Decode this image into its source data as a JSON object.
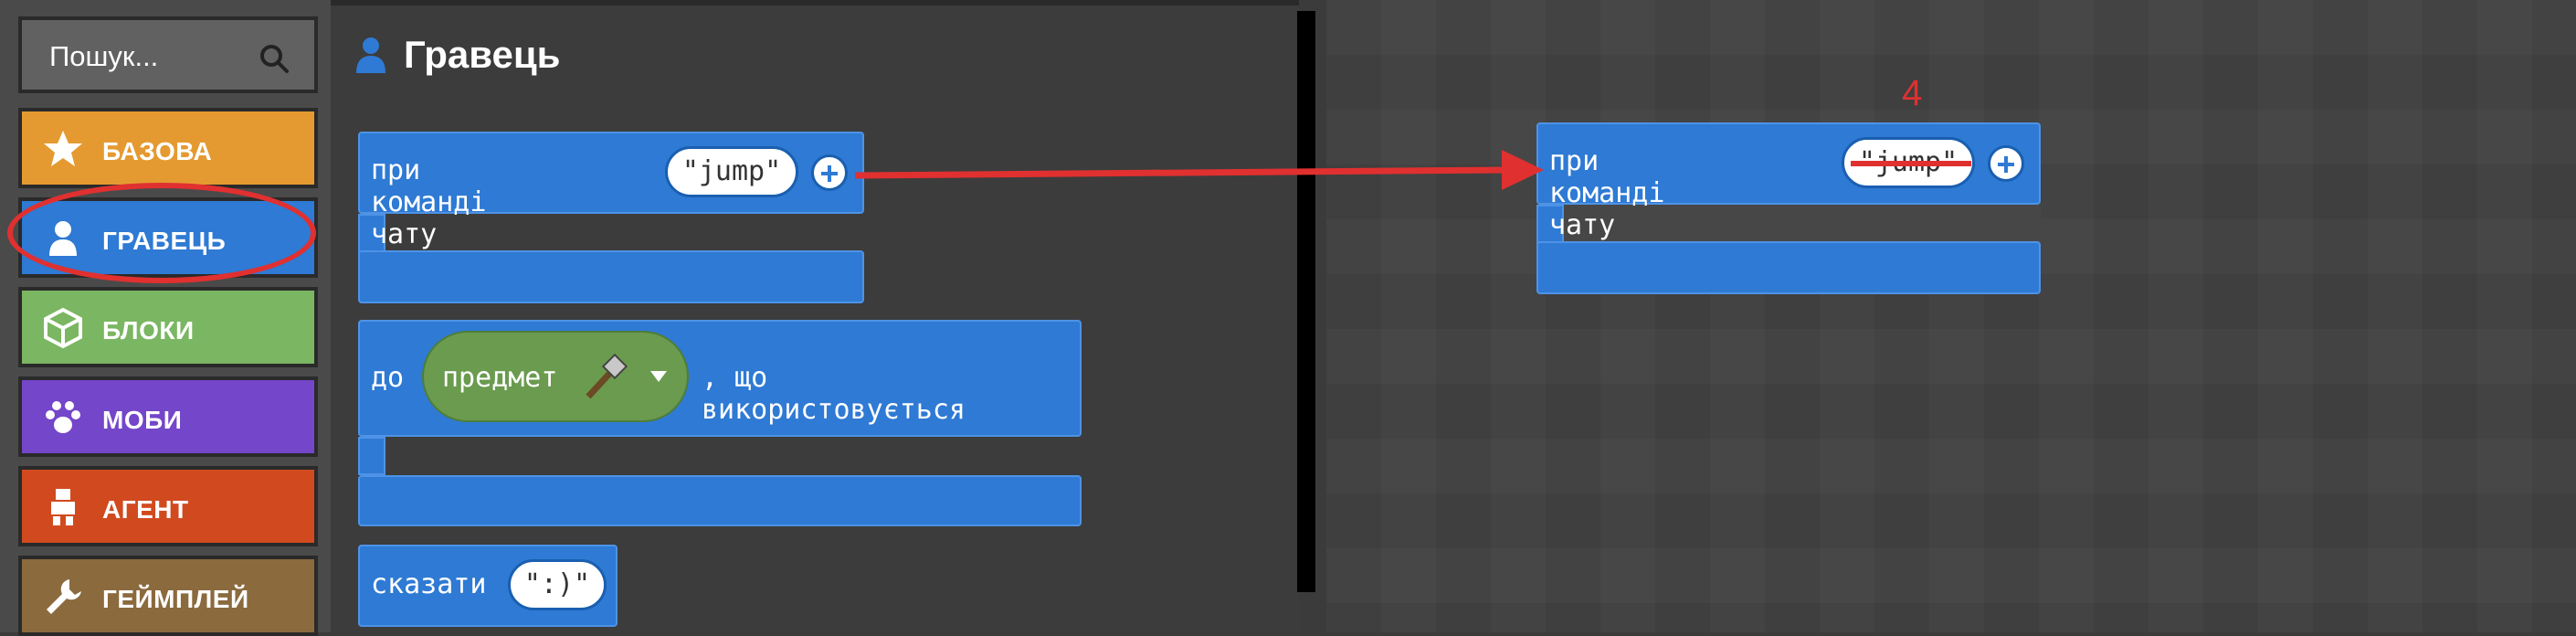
{
  "sidebar": {
    "search_placeholder": "Пошук...",
    "categories": [
      {
        "label": "БАЗОВА",
        "color": "#e59a31",
        "icon": "star-icon"
      },
      {
        "label": "ГРАВЕЦЬ",
        "color": "#2e7ad4",
        "icon": "person-icon"
      },
      {
        "label": "БЛОКИ",
        "color": "#7bb662",
        "icon": "cube-icon"
      },
      {
        "label": "МОБИ",
        "color": "#7446c9",
        "icon": "paw-icon"
      },
      {
        "label": "АГЕНТ",
        "color": "#d14a1f",
        "icon": "robot-icon"
      },
      {
        "label": "ГЕЙМПЛЕЙ",
        "color": "#8b6a3e",
        "icon": "wrench-icon"
      }
    ],
    "highlight_color": "#e03030"
  },
  "flyout": {
    "title": "Гравець",
    "blocks": {
      "on_chat": {
        "label": "при команді чату",
        "value": "\"jump\""
      },
      "item_used": {
        "prefix": "до",
        "item_label": "предмет",
        "suffix": ", що використовується"
      },
      "say": {
        "label": "сказати",
        "value": "\":)\""
      }
    }
  },
  "workspace": {
    "annotation_number": "4",
    "block": {
      "label": "при команді чату",
      "value": "\"jump\""
    }
  },
  "colors": {
    "player_blue": "#2e7ad4",
    "annotation_red": "#e03030",
    "item_green": "#6a9b4f"
  }
}
